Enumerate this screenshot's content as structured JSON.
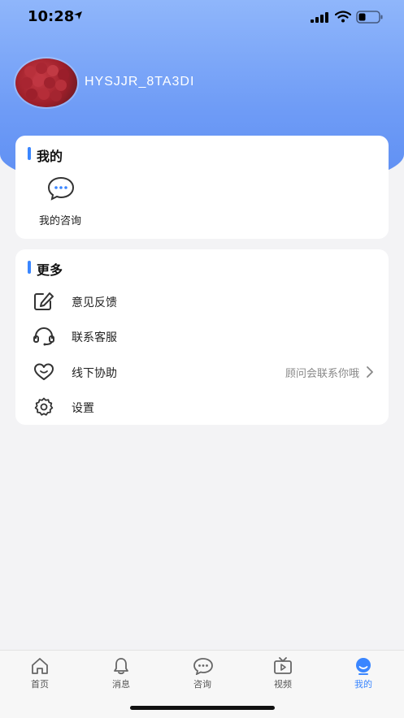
{
  "status_bar": {
    "time": "10:28"
  },
  "profile": {
    "username": "HYSJJR_8TA3DI"
  },
  "mine_section": {
    "title": "我的",
    "items": [
      {
        "label": "我的咨询",
        "icon": "chat-bubble-icon"
      }
    ]
  },
  "more_section": {
    "title": "更多",
    "items": [
      {
        "label": "意见反馈",
        "icon": "edit-icon",
        "hint": ""
      },
      {
        "label": "联系客服",
        "icon": "headset-icon",
        "hint": ""
      },
      {
        "label": "线下协助",
        "icon": "heart-icon",
        "hint": "顾问会联系你哦"
      },
      {
        "label": "设置",
        "icon": "gear-icon",
        "hint": ""
      }
    ]
  },
  "tabbar": {
    "tabs": [
      {
        "label": "首页",
        "icon": "home-icon"
      },
      {
        "label": "消息",
        "icon": "bell-icon"
      },
      {
        "label": "咨询",
        "icon": "chat-icon"
      },
      {
        "label": "视频",
        "icon": "tv-icon"
      },
      {
        "label": "我的",
        "icon": "profile-icon",
        "active": true
      }
    ]
  },
  "colors": {
    "accent": "#3a86ff",
    "header_top": "#8fb6fb",
    "header_bottom": "#5c8df3"
  }
}
